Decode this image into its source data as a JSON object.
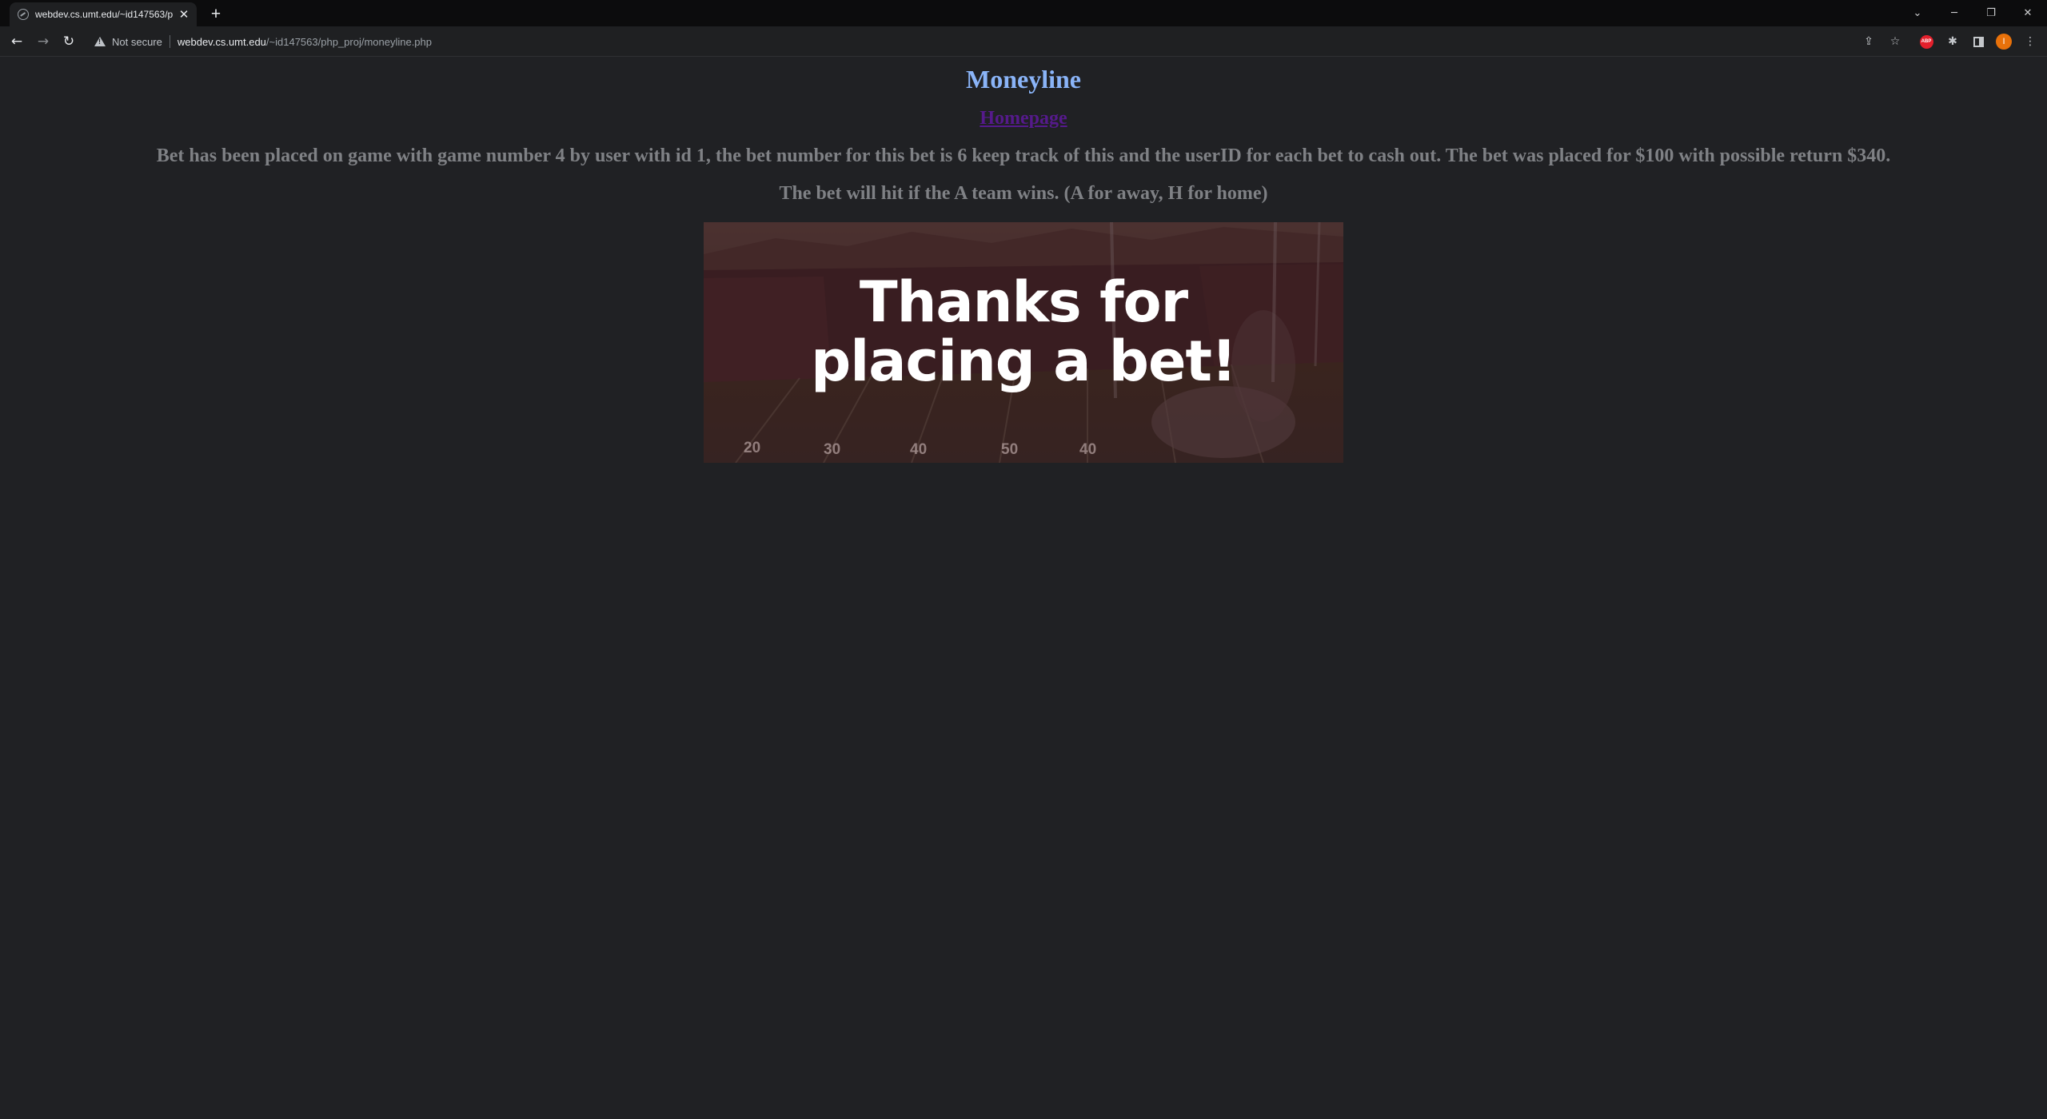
{
  "browser": {
    "tab_title": "webdev.cs.umt.edu/~id147563/p",
    "security_label": "Not secure",
    "url_host": "webdev.cs.umt.edu",
    "url_path": "/~id147563/php_proj/moneyline.php",
    "profile_initial": "I",
    "adblock_label": "ABP"
  },
  "page": {
    "title": "Moneyline",
    "home_link": "Homepage",
    "bet_message": "Bet has been placed on game with game number 4 by user with id 1, the bet number for this bet is 6 keep track of this and the userID for each bet to cash out. The bet was placed for $100 with possible return $340.",
    "hit_message": "The bet will hit if the A team wins. (A for away, H for home)",
    "banner": {
      "line1": "Thanks for",
      "line2": "placing a bet!",
      "yard_markers": [
        "20",
        "30",
        "40",
        "50",
        "40"
      ]
    }
  },
  "colors": {
    "title": "#8ab4f8",
    "link_visited": "#551a8b",
    "body_text": "#7f8185",
    "background": "#202124"
  }
}
